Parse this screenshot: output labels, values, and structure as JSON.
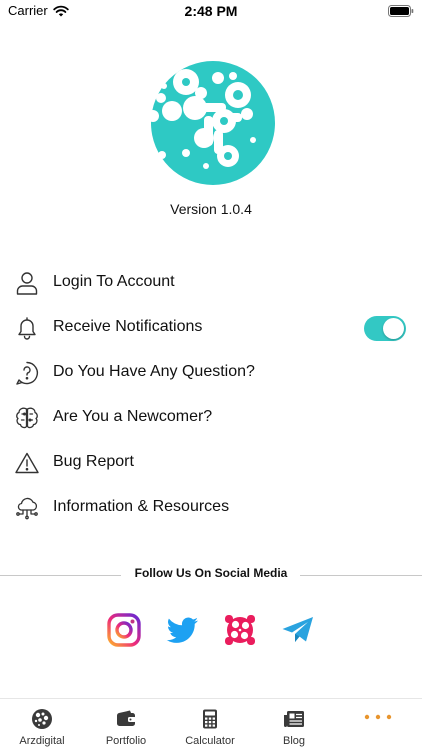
{
  "status": {
    "carrier": "Carrier",
    "time": "2:48 PM"
  },
  "app": {
    "version": "Version 1.0.4"
  },
  "menu": {
    "items": [
      {
        "label": "Login To Account",
        "icon": "user-icon"
      },
      {
        "label": "Receive Notifications",
        "icon": "bell-icon",
        "toggle": true
      },
      {
        "label": "Do You Have Any Question?",
        "icon": "question-icon"
      },
      {
        "label": "Are You a Newcomer?",
        "icon": "brain-icon"
      },
      {
        "label": "Bug Report",
        "icon": "warning-icon"
      },
      {
        "label": "Information & Resources",
        "icon": "cloud-network-icon"
      }
    ]
  },
  "social": {
    "heading": "Follow Us On Social Media",
    "links": [
      "instagram-icon",
      "twitter-icon",
      "aparat-icon",
      "telegram-icon"
    ]
  },
  "tabbar": {
    "tabs": [
      {
        "label": "Arzdigital",
        "icon": "arzdigital-icon"
      },
      {
        "label": "Portfolio",
        "icon": "wallet-icon"
      },
      {
        "label": "Calculator",
        "icon": "calculator-icon"
      },
      {
        "label": "Blog",
        "icon": "newspaper-icon"
      },
      {
        "label": "",
        "icon": "more-icon"
      }
    ]
  },
  "colors": {
    "accent": "#33c8c4",
    "more": "#e8952e",
    "instagram": "#d6249f",
    "twitter": "#1da1f2",
    "aparat": "#ea1d5d",
    "telegram": "#2aa3df"
  }
}
